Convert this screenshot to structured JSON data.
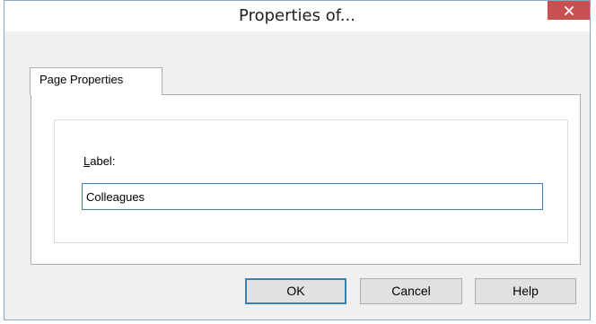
{
  "window": {
    "title": "Properties of..."
  },
  "tabs": [
    {
      "label": "Page Properties",
      "selected": true
    }
  ],
  "form": {
    "label_prefix_underlined": "L",
    "label_rest": "abel:",
    "label_value": "Colleagues"
  },
  "buttons": {
    "ok_label": "OK",
    "cancel_label": "Cancel",
    "help_label": "Help"
  },
  "icons": {
    "close": "close-icon"
  },
  "colors": {
    "close_button_bg": "#c75050",
    "dialog_bg": "#f0f0f0",
    "input_border": "#3c7fb1"
  }
}
